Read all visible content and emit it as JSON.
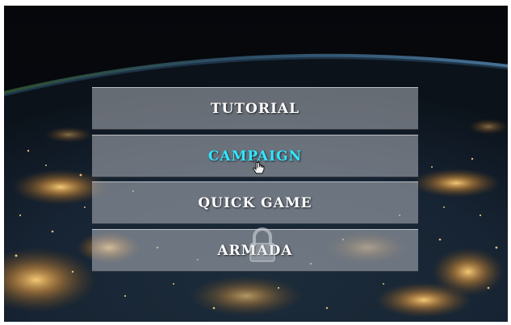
{
  "menu": {
    "items": [
      {
        "label": "TUTORIAL",
        "active": false
      },
      {
        "label": "CAMPAIGN",
        "active": true
      },
      {
        "label": "QUICK GAME",
        "active": false
      },
      {
        "label": "ARMADA",
        "active": false
      }
    ]
  },
  "colors": {
    "active_text": "#32e6ff",
    "default_text": "#ffffff",
    "button_fill": "rgba(178,182,190,0.55)"
  },
  "icons": {
    "background": "earth-at-night-from-orbit",
    "pointer": "hand-pointer-icon",
    "locked_overlay": "padlock-icon"
  }
}
